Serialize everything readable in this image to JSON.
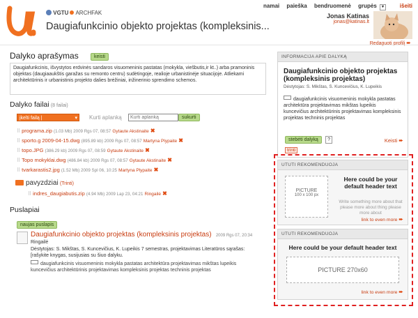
{
  "header": {
    "org": "VGTU",
    "org2": "ARCHFAK",
    "title": "Daugiafunkcinio objekto projektas (kompleksinis...",
    "nav": [
      "namai",
      "paieška",
      "bendruomenė",
      "grupės"
    ],
    "logout": "išeiti",
    "user_name": "Jonas Katinas",
    "user_email": "jonas@katinas.lt",
    "edit_profile": "Redaguoti profilį"
  },
  "description": {
    "heading": "Dalyko aprašymas",
    "edit_button": "keisti",
    "text": "Daugiafunkcinis, išvystytos erdvinės sandaros visuomeninis pastatas (mokykla, viešbutis,ir kt..) arba pramoninis objektas (daugiaaukštis garažas su remonto centru) sudėtingoje, realioje urbanistinėje situacijoje. Atliekami architektūrinis ir urbanistinis projekto dalies brėžiniai, inžinerinio sprendimo schemos."
  },
  "files": {
    "heading": "Dalyko failai",
    "count": "(8 failai)",
    "upload_select": "įkelti failą |",
    "new_folder_placeholder": "Kurti aplanką",
    "create_button": "sukurti",
    "items": [
      {
        "name": "programa.zip",
        "meta": "(1.03 Mb) 2009 Rgs 07, 08:57",
        "author": "Gytaute Akstinaite"
      },
      {
        "name": "sporto.g 2009-04-15.dwg",
        "meta": "(895.89 kb) 2009 Rgs 07, 08:57",
        "author": "Martyna Plypaite"
      },
      {
        "name": "topo.JPG",
        "meta": "(386.29 kb) 2009 Rgs 07, 08:59",
        "author": "Gytaute Akstinaite"
      },
      {
        "name": "Topo mokyklai.dwg",
        "meta": "(486.84 kb) 2009 Rgs 07, 08:57",
        "author": "Gytaute Akstinaite"
      },
      {
        "name": "tvarkarastis2.jpg",
        "meta": "(1.52 Mb) 2009 Spl 06, 10:25",
        "author": "Martyna Plypaite"
      }
    ],
    "folder": {
      "name": "pavyzdziai",
      "delete": "(Trinti)",
      "item": {
        "name": "indres_daugiabutis.zip",
        "meta": "(4.94 Mb) 2009 Lap 23, 04:21",
        "author": "Ringailė"
      }
    }
  },
  "pages": {
    "heading": "Puslapiai",
    "new_button": "naujas puslapis",
    "item": {
      "title": "Daugiafunkcinio objekto projektas (kompleksinis projektas)",
      "date": "2009 Rgs 07, 20:34",
      "author": "Ringailė",
      "teachers": "Dėstytojas: S. Mikštas, S. Kuncevičius, K. Lupeikis 7 semestras, projektavimas Literatūros sąrašas:",
      "note": "[rašykite knygas, susijusias su šiuo dalyku.",
      "tags": "daugiafunkcinis visuomeninis mokykla pastatas architektūra projektavimas mikštas lupeikis kuncevičius architektūrinis projektavimas kompleksinis projektas techninis projektas"
    }
  },
  "info": {
    "header": "INFORMACIJA APIE DALYKĄ",
    "title": "Daugiafunkcinio objekto projektas (kompleksinis projektas)",
    "teachers": "Dėstytojas: S. Mikštas, S. Kuncevičius, K. Lupeikis",
    "tags": "daugiafunkcinis visuomeninis mokykla pastatas architektūra projektavimas mikštas lupeikis kuncevičius architektūrinis projektavimas kompleksinis projektas techninis projektas",
    "follow_button": "stebėti dalyką",
    "help": "?",
    "edit": "Keisti",
    "delete": "trinti"
  },
  "recommend1": {
    "header": "UTUTI REKOMENDUOJA",
    "picture": "PICTURE",
    "picture_size": "100 x 100 px",
    "heading": "Here could be your default header text",
    "body": "Write something more about that please more about thing please more about",
    "link": "link to even more"
  },
  "recommend2": {
    "header": "UTUTI REKOMENDUOJA",
    "heading": "Here could be your default header text",
    "picture": "PICTURE 270x60",
    "link": "link to even more"
  },
  "colors": {
    "accent": "#e04a10",
    "green": "#b7d98a",
    "logo": "#f07020",
    "highlight_border": "#e02020"
  }
}
